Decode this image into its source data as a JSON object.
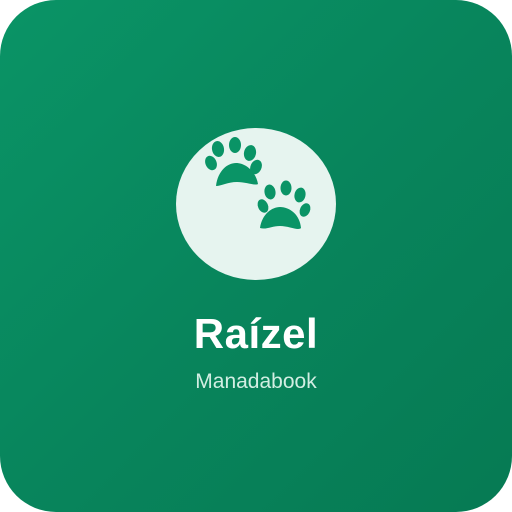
{
  "app": {
    "name": "Raízel",
    "subtitle": "Manadabook",
    "icon": "paw-prints-icon"
  },
  "colors": {
    "background_start": "#0a9466",
    "background_end": "#067a53",
    "circle": "#e6f4ef",
    "paw": "#0a9466",
    "title": "#ffffff",
    "subtitle": "#d2eee3"
  }
}
